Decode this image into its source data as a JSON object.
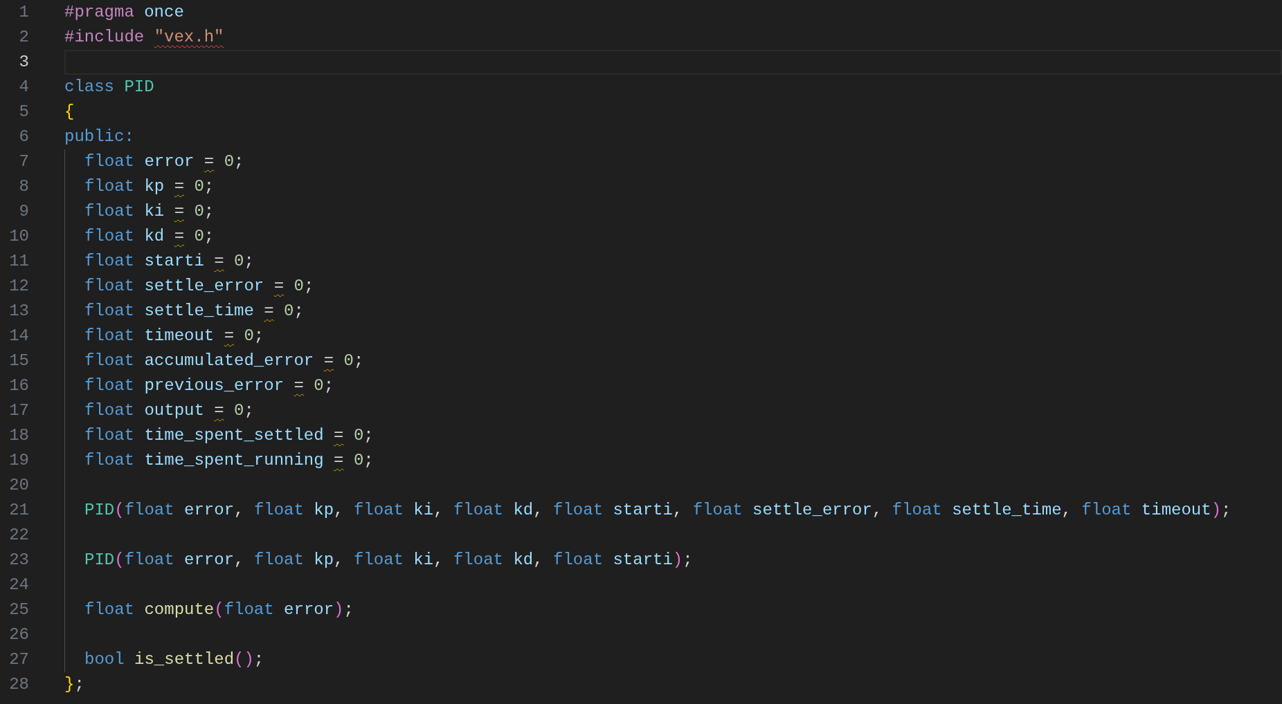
{
  "editor": {
    "lines": [
      {
        "number": "1",
        "current": false,
        "indented": false,
        "tokens": [
          {
            "text": "#pragma ",
            "kind": "directive"
          },
          {
            "text": "once",
            "kind": "ident"
          }
        ]
      },
      {
        "number": "2",
        "current": false,
        "indented": false,
        "tokens": [
          {
            "text": "#include ",
            "kind": "directive"
          },
          {
            "text": "\"vex.h\"",
            "kind": "string",
            "error_squiggle": true
          }
        ]
      },
      {
        "number": "3",
        "current": true,
        "indented": false
      },
      {
        "number": "4",
        "current": false,
        "indented": false,
        "tokens": [
          {
            "text": "class ",
            "kind": "keyword"
          },
          {
            "text": "PID",
            "kind": "class"
          }
        ]
      },
      {
        "number": "5",
        "current": false,
        "indented": false,
        "tokens": [
          {
            "text": "{",
            "kind": "brace"
          }
        ]
      },
      {
        "number": "6",
        "current": false,
        "indented": false,
        "tokens": [
          {
            "text": "public:",
            "kind": "keyword"
          }
        ]
      },
      {
        "number": "7",
        "current": false,
        "indented": true,
        "tokens": [
          {
            "text": "float ",
            "kind": "keyword"
          },
          {
            "text": "error ",
            "kind": "ident"
          },
          {
            "text": "=",
            "kind": "plain",
            "warning_squiggle": true
          },
          {
            "text": " 0",
            "kind": "number"
          },
          {
            "text": ";",
            "kind": "plain"
          }
        ]
      },
      {
        "number": "8",
        "current": false,
        "indented": true,
        "tokens": [
          {
            "text": "float ",
            "kind": "keyword"
          },
          {
            "text": "kp ",
            "kind": "ident"
          },
          {
            "text": "=",
            "kind": "plain",
            "warning_squiggle": true
          },
          {
            "text": " 0",
            "kind": "number"
          },
          {
            "text": ";",
            "kind": "plain"
          }
        ]
      },
      {
        "number": "9",
        "current": false,
        "indented": true,
        "tokens": [
          {
            "text": "float ",
            "kind": "keyword"
          },
          {
            "text": "ki ",
            "kind": "ident"
          },
          {
            "text": "=",
            "kind": "plain",
            "warning_squiggle": true
          },
          {
            "text": " 0",
            "kind": "number"
          },
          {
            "text": ";",
            "kind": "plain"
          }
        ]
      },
      {
        "number": "10",
        "current": false,
        "indented": true,
        "tokens": [
          {
            "text": "float ",
            "kind": "keyword"
          },
          {
            "text": "kd ",
            "kind": "ident"
          },
          {
            "text": "=",
            "kind": "plain",
            "warning_squiggle": true
          },
          {
            "text": " 0",
            "kind": "number"
          },
          {
            "text": ";",
            "kind": "plain"
          }
        ]
      },
      {
        "number": "11",
        "current": false,
        "indented": true,
        "tokens": [
          {
            "text": "float ",
            "kind": "keyword"
          },
          {
            "text": "starti ",
            "kind": "ident"
          },
          {
            "text": "=",
            "kind": "plain",
            "warning_squiggle": true
          },
          {
            "text": " 0",
            "kind": "number"
          },
          {
            "text": ";",
            "kind": "plain"
          }
        ]
      },
      {
        "number": "12",
        "current": false,
        "indented": true,
        "tokens": [
          {
            "text": "float ",
            "kind": "keyword"
          },
          {
            "text": "settle_error ",
            "kind": "ident"
          },
          {
            "text": "=",
            "kind": "plain",
            "warning_squiggle": true
          },
          {
            "text": " 0",
            "kind": "number"
          },
          {
            "text": ";",
            "kind": "plain"
          }
        ]
      },
      {
        "number": "13",
        "current": false,
        "indented": true,
        "tokens": [
          {
            "text": "float ",
            "kind": "keyword"
          },
          {
            "text": "settle_time ",
            "kind": "ident"
          },
          {
            "text": "=",
            "kind": "plain",
            "warning_squiggle": true
          },
          {
            "text": " 0",
            "kind": "number"
          },
          {
            "text": ";",
            "kind": "plain"
          }
        ]
      },
      {
        "number": "14",
        "current": false,
        "indented": true,
        "tokens": [
          {
            "text": "float ",
            "kind": "keyword"
          },
          {
            "text": "timeout ",
            "kind": "ident"
          },
          {
            "text": "=",
            "kind": "plain",
            "warning_squiggle": true
          },
          {
            "text": " 0",
            "kind": "number"
          },
          {
            "text": ";",
            "kind": "plain"
          }
        ]
      },
      {
        "number": "15",
        "current": false,
        "indented": true,
        "tokens": [
          {
            "text": "float ",
            "kind": "keyword"
          },
          {
            "text": "accumulated_error ",
            "kind": "ident"
          },
          {
            "text": "=",
            "kind": "plain",
            "warning_squiggle": true
          },
          {
            "text": " 0",
            "kind": "number"
          },
          {
            "text": ";",
            "kind": "plain"
          }
        ]
      },
      {
        "number": "16",
        "current": false,
        "indented": true,
        "tokens": [
          {
            "text": "float ",
            "kind": "keyword"
          },
          {
            "text": "previous_error ",
            "kind": "ident"
          },
          {
            "text": "=",
            "kind": "plain",
            "warning_squiggle": true
          },
          {
            "text": " 0",
            "kind": "number"
          },
          {
            "text": ";",
            "kind": "plain"
          }
        ]
      },
      {
        "number": "17",
        "current": false,
        "indented": true,
        "tokens": [
          {
            "text": "float ",
            "kind": "keyword"
          },
          {
            "text": "output ",
            "kind": "ident"
          },
          {
            "text": "=",
            "kind": "plain",
            "warning_squiggle": true
          },
          {
            "text": " 0",
            "kind": "number"
          },
          {
            "text": ";",
            "kind": "plain"
          }
        ]
      },
      {
        "number": "18",
        "current": false,
        "indented": true,
        "tokens": [
          {
            "text": "float ",
            "kind": "keyword"
          },
          {
            "text": "time_spent_settled ",
            "kind": "ident"
          },
          {
            "text": "=",
            "kind": "plain",
            "warning_squiggle": true
          },
          {
            "text": " 0",
            "kind": "number"
          },
          {
            "text": ";",
            "kind": "plain"
          }
        ]
      },
      {
        "number": "19",
        "current": false,
        "indented": true,
        "tokens": [
          {
            "text": "float ",
            "kind": "keyword"
          },
          {
            "text": "time_spent_running ",
            "kind": "ident"
          },
          {
            "text": "=",
            "kind": "plain",
            "warning_squiggle": true
          },
          {
            "text": " 0",
            "kind": "number"
          },
          {
            "text": ";",
            "kind": "plain"
          }
        ]
      },
      {
        "number": "20",
        "current": false,
        "indented": true
      },
      {
        "number": "21",
        "current": false,
        "indented": true,
        "tokens": [
          {
            "text": "PID",
            "kind": "class"
          },
          {
            "text": "(",
            "kind": "paren"
          },
          {
            "text": "float ",
            "kind": "keyword"
          },
          {
            "text": "error",
            "kind": "ident"
          },
          {
            "text": ", ",
            "kind": "plain"
          },
          {
            "text": "float ",
            "kind": "keyword"
          },
          {
            "text": "kp",
            "kind": "ident"
          },
          {
            "text": ", ",
            "kind": "plain"
          },
          {
            "text": "float ",
            "kind": "keyword"
          },
          {
            "text": "ki",
            "kind": "ident"
          },
          {
            "text": ", ",
            "kind": "plain"
          },
          {
            "text": "float ",
            "kind": "keyword"
          },
          {
            "text": "kd",
            "kind": "ident"
          },
          {
            "text": ", ",
            "kind": "plain"
          },
          {
            "text": "float ",
            "kind": "keyword"
          },
          {
            "text": "starti",
            "kind": "ident"
          },
          {
            "text": ", ",
            "kind": "plain"
          },
          {
            "text": "float ",
            "kind": "keyword"
          },
          {
            "text": "settle_error",
            "kind": "ident"
          },
          {
            "text": ", ",
            "kind": "plain"
          },
          {
            "text": "float ",
            "kind": "keyword"
          },
          {
            "text": "settle_time",
            "kind": "ident"
          },
          {
            "text": ", ",
            "kind": "plain"
          },
          {
            "text": "float ",
            "kind": "keyword"
          },
          {
            "text": "timeout",
            "kind": "ident"
          },
          {
            "text": ")",
            "kind": "paren"
          },
          {
            "text": ";",
            "kind": "plain"
          }
        ]
      },
      {
        "number": "22",
        "current": false,
        "indented": true
      },
      {
        "number": "23",
        "current": false,
        "indented": true,
        "tokens": [
          {
            "text": "PID",
            "kind": "class"
          },
          {
            "text": "(",
            "kind": "paren"
          },
          {
            "text": "float ",
            "kind": "keyword"
          },
          {
            "text": "error",
            "kind": "ident"
          },
          {
            "text": ", ",
            "kind": "plain"
          },
          {
            "text": "float ",
            "kind": "keyword"
          },
          {
            "text": "kp",
            "kind": "ident"
          },
          {
            "text": ", ",
            "kind": "plain"
          },
          {
            "text": "float ",
            "kind": "keyword"
          },
          {
            "text": "ki",
            "kind": "ident"
          },
          {
            "text": ", ",
            "kind": "plain"
          },
          {
            "text": "float ",
            "kind": "keyword"
          },
          {
            "text": "kd",
            "kind": "ident"
          },
          {
            "text": ", ",
            "kind": "plain"
          },
          {
            "text": "float ",
            "kind": "keyword"
          },
          {
            "text": "starti",
            "kind": "ident"
          },
          {
            "text": ")",
            "kind": "paren"
          },
          {
            "text": ";",
            "kind": "plain"
          }
        ]
      },
      {
        "number": "24",
        "current": false,
        "indented": true
      },
      {
        "number": "25",
        "current": false,
        "indented": true,
        "tokens": [
          {
            "text": "float ",
            "kind": "keyword"
          },
          {
            "text": "compute",
            "kind": "function"
          },
          {
            "text": "(",
            "kind": "paren"
          },
          {
            "text": "float ",
            "kind": "keyword"
          },
          {
            "text": "error",
            "kind": "ident"
          },
          {
            "text": ")",
            "kind": "paren"
          },
          {
            "text": ";",
            "kind": "plain"
          }
        ]
      },
      {
        "number": "26",
        "current": false,
        "indented": true
      },
      {
        "number": "27",
        "current": false,
        "indented": true,
        "tokens": [
          {
            "text": "bool ",
            "kind": "keyword"
          },
          {
            "text": "is_settled",
            "kind": "function"
          },
          {
            "text": "()",
            "kind": "paren"
          },
          {
            "text": ";",
            "kind": "plain"
          }
        ]
      },
      {
        "number": "28",
        "current": false,
        "indented": false,
        "tokens": [
          {
            "text": "}",
            "kind": "brace"
          },
          {
            "text": ";",
            "kind": "plain"
          }
        ]
      }
    ]
  }
}
